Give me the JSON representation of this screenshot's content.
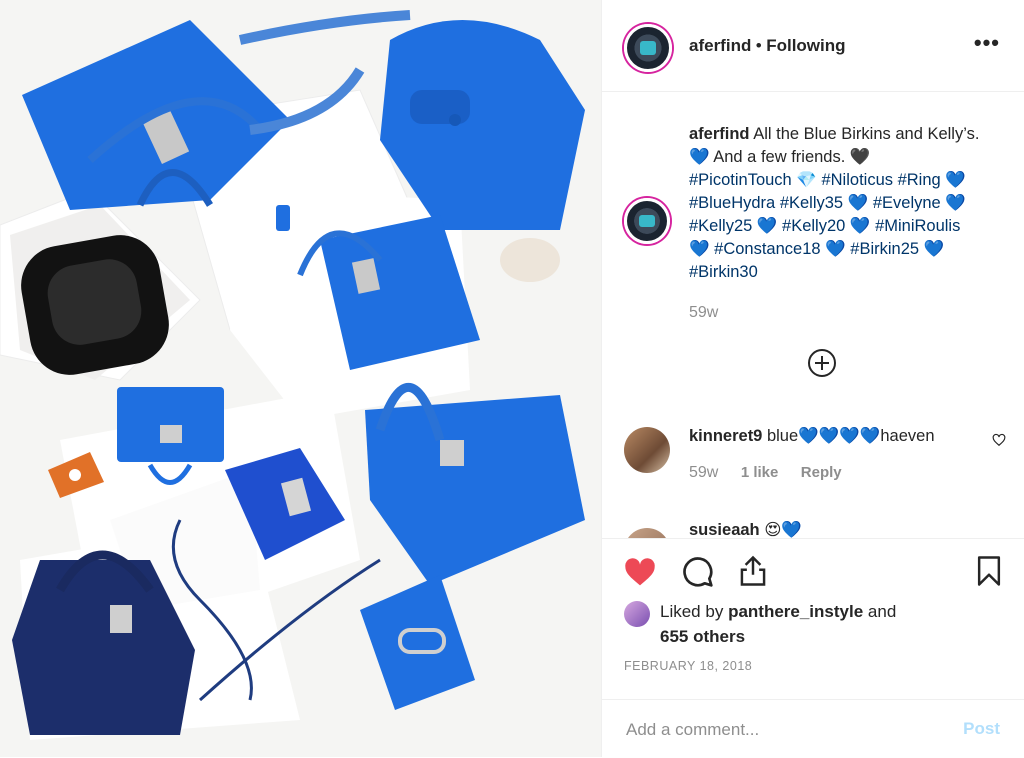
{
  "post": {
    "username": "aferfind",
    "separator": "•",
    "follow_status": "Following",
    "more_icon": "more-dots-icon"
  },
  "caption": {
    "username": "aferfind",
    "text_1": "All the Blue Birkins and Kelly’s.",
    "text_2": "And a few friends.",
    "hashtags": [
      "#PicotinTouch",
      "#Niloticus",
      "#Ring",
      "#BlueHydra",
      "#Kelly35",
      "#Evelyne",
      "#Kelly25",
      "#Kelly20",
      "#MiniRoulis",
      "#Constance18",
      "#Birkin25",
      "#Birkin30"
    ],
    "time": "59w"
  },
  "comments": [
    {
      "username": "kinneret9",
      "text": "blue",
      "text_end": "haeven",
      "time": "59w",
      "likes": "1 like",
      "reply": "Reply"
    },
    {
      "username": "susieaah"
    }
  ],
  "actions": {
    "liked_by_prefix": "Liked by",
    "liked_by_user": "panthere_instyle",
    "liked_by_and": "and",
    "others": "655 others",
    "date": "FEBRUARY 18, 2018"
  },
  "comment_box": {
    "placeholder": "Add a comment...",
    "post_label": "Post"
  },
  "colors": {
    "like_red": "#ed4956",
    "hashtag_blue": "#003569",
    "post_disabled": "#b2dffc",
    "bag_blue": "#1f6fe0"
  }
}
